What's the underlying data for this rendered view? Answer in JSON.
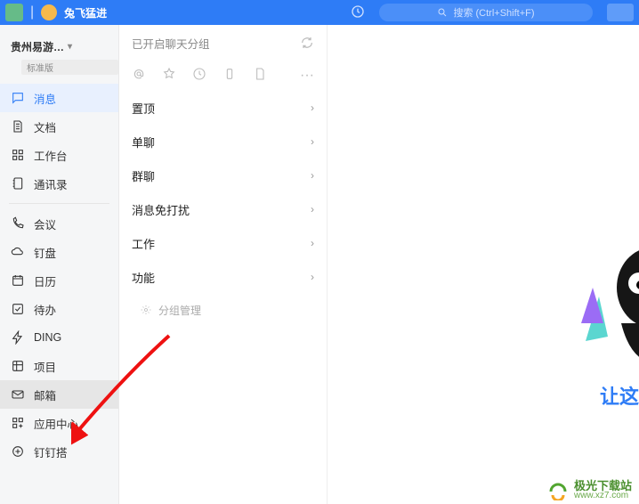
{
  "top": {
    "username": "兔飞猛进",
    "search_placeholder": "搜索 (Ctrl+Shift+F)"
  },
  "org": {
    "name": "贵州易游…",
    "badge": "标准版"
  },
  "sidebar": {
    "items": [
      {
        "id": "messages",
        "label": "消息"
      },
      {
        "id": "docs",
        "label": "文档"
      },
      {
        "id": "workbench",
        "label": "工作台"
      },
      {
        "id": "contacts",
        "label": "通讯录"
      },
      {
        "id": "meeting",
        "label": "会议"
      },
      {
        "id": "drive",
        "label": "钉盘"
      },
      {
        "id": "calendar",
        "label": "日历"
      },
      {
        "id": "todo",
        "label": "待办"
      },
      {
        "id": "ding",
        "label": "DING"
      },
      {
        "id": "project",
        "label": "项目"
      },
      {
        "id": "mail",
        "label": "邮箱"
      },
      {
        "id": "appcenter",
        "label": "应用中心"
      },
      {
        "id": "dbuild",
        "label": "钉钉搭"
      }
    ]
  },
  "list": {
    "header": "已开启聊天分组",
    "groups": [
      {
        "label": "置顶"
      },
      {
        "label": "单聊"
      },
      {
        "label": "群聊"
      },
      {
        "label": "消息免打扰"
      },
      {
        "label": "工作"
      },
      {
        "label": "功能"
      }
    ],
    "manage_label": "分组管理"
  },
  "content": {
    "blue_text": "让这"
  },
  "watermark": {
    "cn": "极光下载站",
    "url": "www.xz7.com"
  }
}
